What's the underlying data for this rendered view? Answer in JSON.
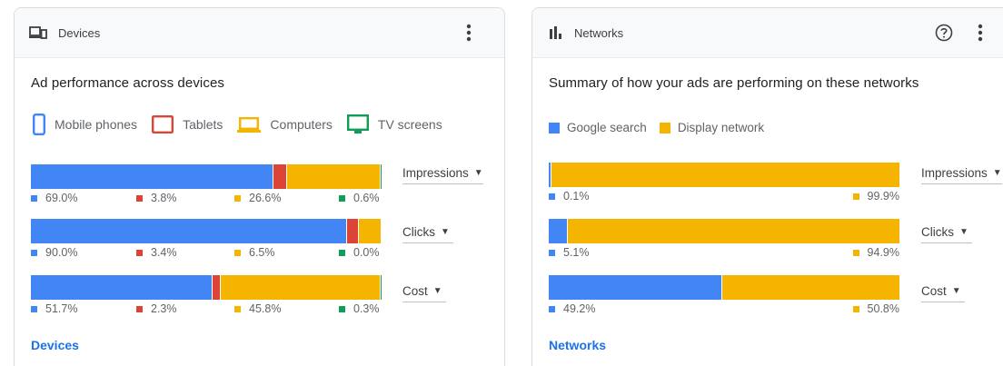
{
  "colors": {
    "blue": "#4285f4",
    "red": "#db4437",
    "yellow": "#f4b400",
    "green": "#0f9d58",
    "link": "#1a73e8"
  },
  "devices_card": {
    "title": "Devices",
    "header_icon": "devices-icon",
    "subtitle": "Ad performance across devices",
    "legend": [
      "Mobile phones",
      "Tablets",
      "Computers",
      "TV screens"
    ],
    "metrics": [
      {
        "label": "Impressions",
        "values": [
          69.0,
          3.8,
          26.6,
          0.6
        ],
        "labels": [
          "69.0%",
          "3.8%",
          "26.6%",
          "0.6%"
        ]
      },
      {
        "label": "Clicks",
        "values": [
          90.0,
          3.4,
          6.5,
          0.0
        ],
        "labels": [
          "90.0%",
          "3.4%",
          "6.5%",
          "0.0%"
        ]
      },
      {
        "label": "Cost",
        "values": [
          51.7,
          2.3,
          45.8,
          0.3
        ],
        "labels": [
          "51.7%",
          "2.3%",
          "45.8%",
          "0.3%"
        ]
      }
    ],
    "footer_link": "Devices"
  },
  "networks_card": {
    "title": "Networks",
    "header_icon": "bar-chart-icon",
    "subtitle": "Summary of how your ads are performing on these networks",
    "legend": [
      "Google search",
      "Display network"
    ],
    "metrics": [
      {
        "label": "Impressions",
        "values": [
          0.1,
          99.9
        ],
        "labels": [
          "0.1%",
          "99.9%"
        ]
      },
      {
        "label": "Clicks",
        "values": [
          5.1,
          94.9
        ],
        "labels": [
          "5.1%",
          "94.9%"
        ]
      },
      {
        "label": "Cost",
        "values": [
          49.2,
          50.8
        ],
        "labels": [
          "49.2%",
          "50.8%"
        ]
      }
    ],
    "footer_link": "Networks"
  }
}
